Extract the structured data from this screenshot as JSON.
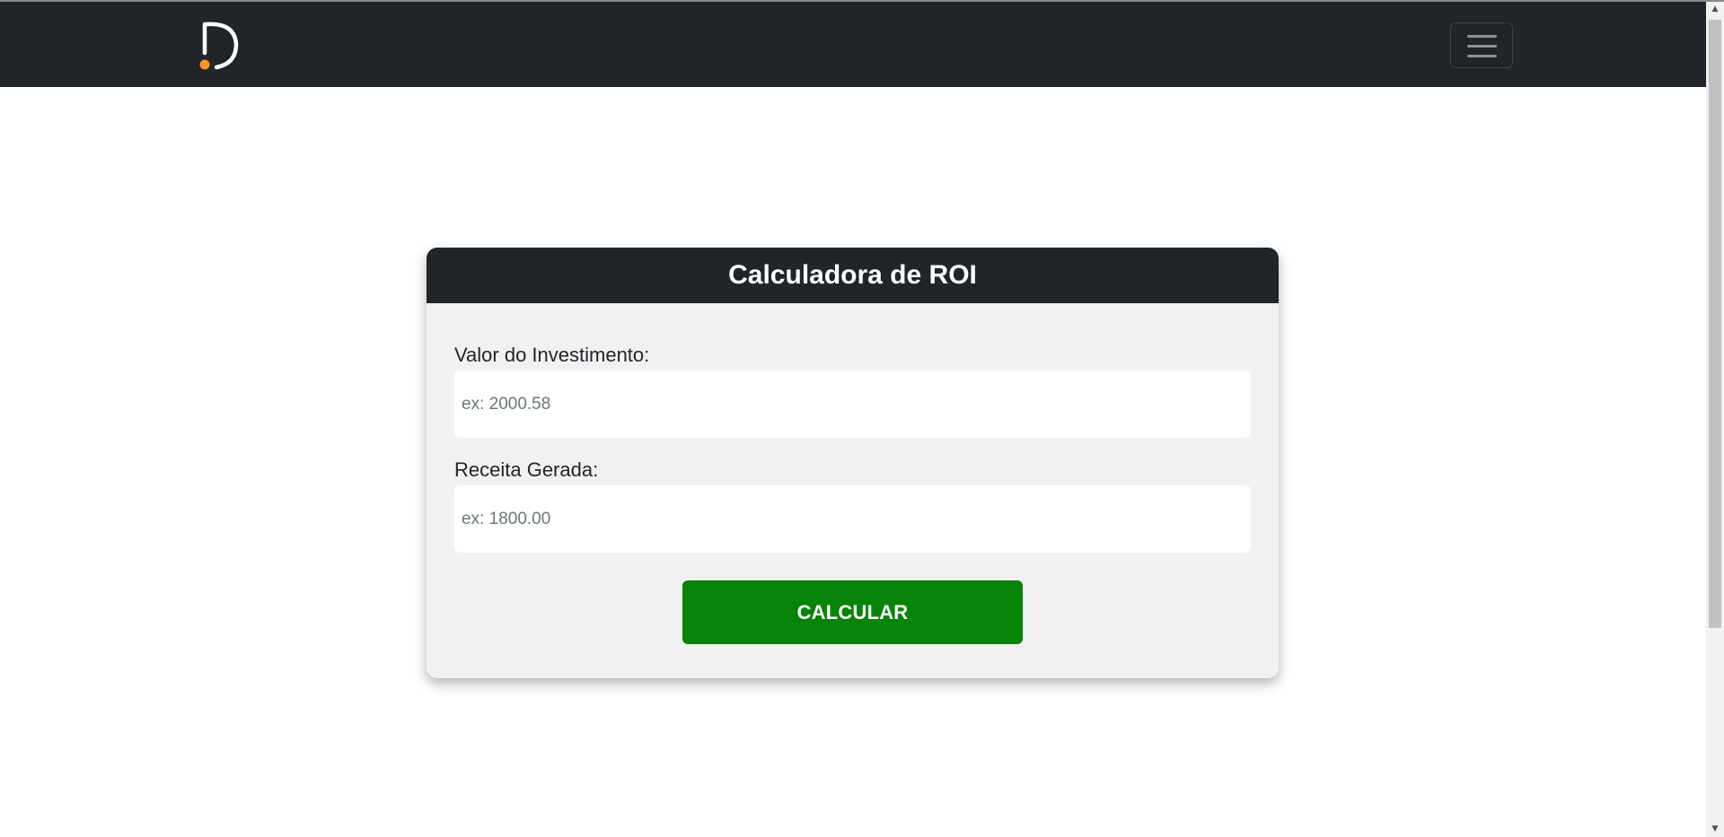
{
  "navbar": {
    "logo_icon": "d-logo-with-orange-dot-icon",
    "menu_icon": "hamburger-menu-icon",
    "background_color": "#212529",
    "logo_accent_color": "#f7941d"
  },
  "calculator": {
    "title": "Calculadora de ROI",
    "investment_label": "Valor do Investimento:",
    "investment_placeholder": "ex: 2000.58",
    "investment_value": "",
    "revenue_label": "Receita Gerada:",
    "revenue_placeholder": "ex: 1800.00",
    "revenue_value": "",
    "calculate_button": "CALCULAR",
    "button_color": "#078307"
  },
  "scrollbar": {
    "up_icon": "scroll-up-arrow-icon",
    "down_icon": "scroll-down-arrow-icon"
  }
}
